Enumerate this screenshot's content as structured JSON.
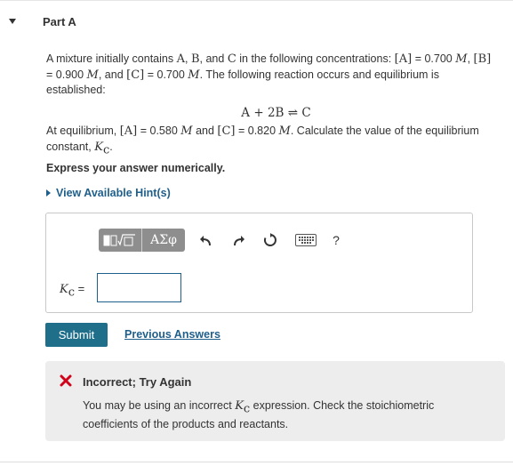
{
  "part": {
    "title": "Part A"
  },
  "problem": {
    "intro": "A mixture initially contains",
    "species_A": "A",
    "species_B": "B",
    "and1": "and",
    "species_C": "C",
    "mid": "in the following concentrations:",
    "conc_A_label": "[A]",
    "conc_A_value": "= 0.700",
    "conc_B_label": "[B]",
    "conc_B_value": "= 0.900",
    "conc_C_label": "[C]",
    "conc_C_value": "= 0.700",
    "unit": "M",
    "and2": ", and",
    "tail": ". The following reaction occurs and equilibrium is established:"
  },
  "equation": {
    "text": "A + 2B ⇌ C"
  },
  "equilibrium": {
    "intro": "At equilibrium,",
    "eq_A_label": "[A]",
    "eq_A_value": "= 0.580",
    "and": "and",
    "eq_C_label": "[C]",
    "eq_C_value": "= 0.820",
    "unit": "M",
    "tail": ". Calculate the value of the equilibrium constant,",
    "kc": "K",
    "kc_sub": "c"
  },
  "instruction": "Express your answer numerically.",
  "hint_link": "View Available Hint(s)",
  "toolbar": {
    "templates_label": "√□",
    "symbols_label": "ΑΣφ",
    "help_label": "?"
  },
  "answer": {
    "label": "K",
    "label_sub": "c",
    "equals": "=",
    "value": ""
  },
  "actions": {
    "submit_label": "Submit",
    "previous_label": "Previous Answers"
  },
  "feedback": {
    "title": "Incorrect; Try Again",
    "body_pre": "You may be using an incorrect",
    "kc": "K",
    "kc_sub": "c",
    "body_post": "expression. Check the stoichiometric coefficients of the products and reactants.",
    "color": "#d0021b"
  }
}
